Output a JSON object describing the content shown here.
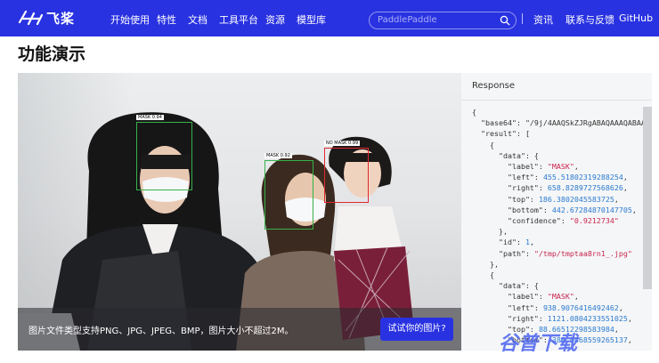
{
  "nav": {
    "logo_text": "飞桨",
    "links": [
      "开始使用",
      "特性",
      "文档",
      "工具平台",
      "资源",
      "模型库"
    ],
    "search_placeholder": "PaddlePaddle",
    "right_links": [
      "资讯",
      "联系与反馈",
      "GitHub"
    ]
  },
  "page": {
    "title": "功能演示"
  },
  "demo": {
    "caption": "图片文件类型支持PNG、JPG、JPEG、BMP，图片大小不超过2M。",
    "try_button": "试试你的图片?",
    "detections": [
      {
        "label": "MASK  0.94",
        "color": "#36b24a"
      },
      {
        "label": "MASK  0.92",
        "color": "#36b24a"
      },
      {
        "label": "NO MASK  0.99",
        "color": "#e2282f"
      }
    ]
  },
  "response": {
    "title": "Response",
    "lines": [
      "{",
      "  \"base64\": \"/9j/4AAQSkZJRgABAQAAAQABAAD",
      "  \"result\": [",
      "    {",
      "      \"data\": {",
      "        \"label\": \"MASK\",",
      "        \"left\": 455.51802319288254,",
      "        \"right\": 658.8289727568626,",
      "        \"top\": 186.3802045583725,",
      "        \"bottom\": 442.67284870147705,",
      "        \"confidence\": \"0.9212734\"",
      "      },",
      "      \"id\": 1,",
      "      \"path\": \"/tmp/tmptaa8rn1_.jpg\"",
      "    },",
      "    {",
      "      \"data\": {",
      "        \"label\": \"MASK\",",
      "        \"left\": 938.9076416492462,",
      "        \"right\": 1121.0804233551025,",
      "        \"top\": 88.66512298583984,",
      "        \"bottom\": 386.0468559265137,"
    ]
  },
  "watermark": "谷普下载"
}
